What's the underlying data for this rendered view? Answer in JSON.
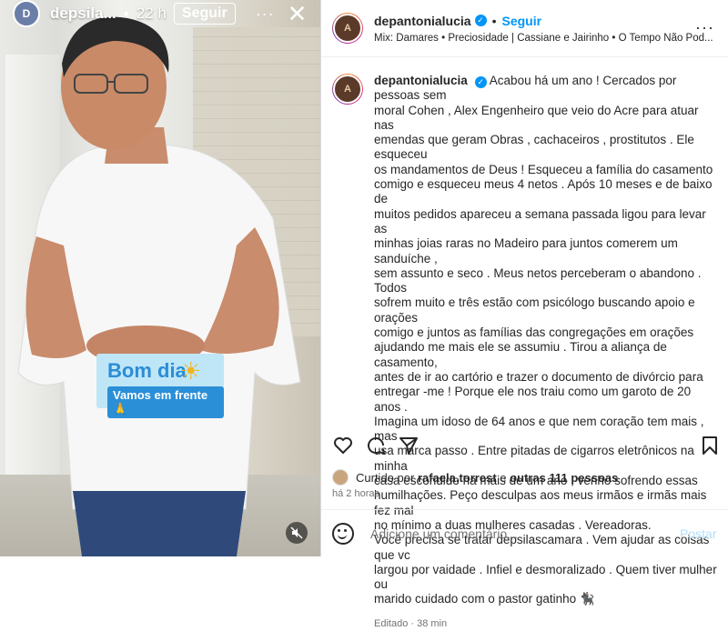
{
  "story": {
    "username": "depsila...",
    "time": "22 h",
    "follow_label": "Seguir",
    "more": "···",
    "close": "✕",
    "sticker_top": "Bom dia",
    "sticker_bottom": "Vamos em frente 🙏"
  },
  "post": {
    "username": "depantonialucia",
    "follow_label": "Seguir",
    "music": "Mix: Damares • Preciosidade | Cassiane e Jairinho • O Tempo Não Pod...",
    "more": "···",
    "caption_lines": [
      "Acabou há um ano ! Cercados por pessoas sem",
      "moral Cohen , Alex Engenheiro que veio do Acre para atuar nas",
      "emendas que geram Obras , cachaceiros , prostitutos . Ele esqueceu",
      "os mandamentos de Deus ! Esqueceu a família do casamento",
      "comigo e esqueceu meus 4 netos . Após 10 meses e de baixo de",
      "muitos pedidos apareceu a semana passada ligou para levar as",
      "minhas joias raras no Madeiro para juntos comerem um sanduíche ,",
      "sem assunto e seco . Meus netos perceberam o abandono . Todos",
      "sofrem muito e três estão com psicólogo buscando apoio e orações",
      "comigo e juntos as famílias das congregações em orações",
      "ajudando me mais ele se assumiu . Tirou a aliança de casamento,",
      "antes de ir ao cartório e trazer o documento de divórcio para",
      "entregar -me ! Porque ele nos traiu como um garoto de 20 anos .",
      "Imagina um idoso de 64 anos e que nem coração tem mais , mas",
      "usa marca passo . Entre pitadas de cigarros eletrônicos na minha",
      "casa escondido ha mais de um ano , venho sofrendo essas",
      "humilhações. Peço desculpas aos meus irmãos e irmãs mais fez mal",
      "no mínimo a duas mulheres casadas . Vereadoras.",
      "Você precisa se tratar depsilascamara . Vem ajudar as coisas que vc",
      "largou por vaidade . Infiel e desmoralizado . Quem tiver mulher ou",
      "marido cuidado com o pastor gatinho 🐈‍⬛"
    ],
    "edited": "Editado · 38 min",
    "likes_prefix": "Curtido por",
    "likes_user": "rafaela.torrest",
    "likes_and": "e",
    "likes_others": "outras 111 pessoas",
    "time_ago": "há 2 horas",
    "comment_placeholder": "Adicione um comentário...",
    "post_label": "Postar"
  },
  "colors": {
    "accent": "#0095f6",
    "post_disabled": "#b2dffc"
  }
}
